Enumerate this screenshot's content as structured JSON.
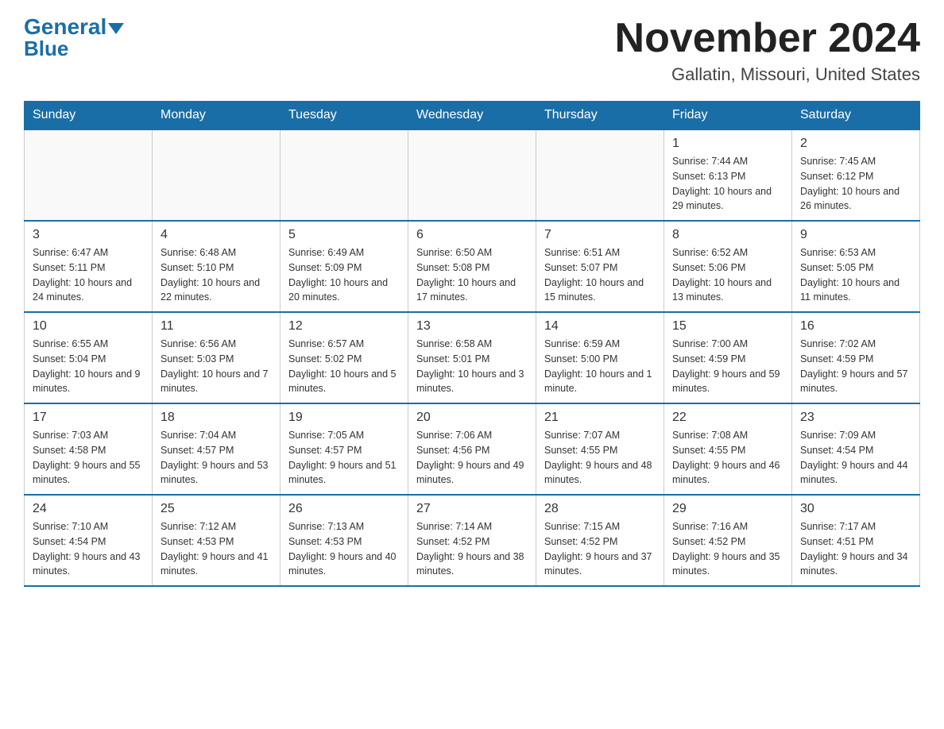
{
  "header": {
    "logo_general": "General",
    "logo_blue": "Blue",
    "month_title": "November 2024",
    "location": "Gallatin, Missouri, United States"
  },
  "weekdays": [
    "Sunday",
    "Monday",
    "Tuesday",
    "Wednesday",
    "Thursday",
    "Friday",
    "Saturday"
  ],
  "weeks": [
    [
      {
        "day": "",
        "info": ""
      },
      {
        "day": "",
        "info": ""
      },
      {
        "day": "",
        "info": ""
      },
      {
        "day": "",
        "info": ""
      },
      {
        "day": "",
        "info": ""
      },
      {
        "day": "1",
        "info": "Sunrise: 7:44 AM\nSunset: 6:13 PM\nDaylight: 10 hours and 29 minutes."
      },
      {
        "day": "2",
        "info": "Sunrise: 7:45 AM\nSunset: 6:12 PM\nDaylight: 10 hours and 26 minutes."
      }
    ],
    [
      {
        "day": "3",
        "info": "Sunrise: 6:47 AM\nSunset: 5:11 PM\nDaylight: 10 hours and 24 minutes."
      },
      {
        "day": "4",
        "info": "Sunrise: 6:48 AM\nSunset: 5:10 PM\nDaylight: 10 hours and 22 minutes."
      },
      {
        "day": "5",
        "info": "Sunrise: 6:49 AM\nSunset: 5:09 PM\nDaylight: 10 hours and 20 minutes."
      },
      {
        "day": "6",
        "info": "Sunrise: 6:50 AM\nSunset: 5:08 PM\nDaylight: 10 hours and 17 minutes."
      },
      {
        "day": "7",
        "info": "Sunrise: 6:51 AM\nSunset: 5:07 PM\nDaylight: 10 hours and 15 minutes."
      },
      {
        "day": "8",
        "info": "Sunrise: 6:52 AM\nSunset: 5:06 PM\nDaylight: 10 hours and 13 minutes."
      },
      {
        "day": "9",
        "info": "Sunrise: 6:53 AM\nSunset: 5:05 PM\nDaylight: 10 hours and 11 minutes."
      }
    ],
    [
      {
        "day": "10",
        "info": "Sunrise: 6:55 AM\nSunset: 5:04 PM\nDaylight: 10 hours and 9 minutes."
      },
      {
        "day": "11",
        "info": "Sunrise: 6:56 AM\nSunset: 5:03 PM\nDaylight: 10 hours and 7 minutes."
      },
      {
        "day": "12",
        "info": "Sunrise: 6:57 AM\nSunset: 5:02 PM\nDaylight: 10 hours and 5 minutes."
      },
      {
        "day": "13",
        "info": "Sunrise: 6:58 AM\nSunset: 5:01 PM\nDaylight: 10 hours and 3 minutes."
      },
      {
        "day": "14",
        "info": "Sunrise: 6:59 AM\nSunset: 5:00 PM\nDaylight: 10 hours and 1 minute."
      },
      {
        "day": "15",
        "info": "Sunrise: 7:00 AM\nSunset: 4:59 PM\nDaylight: 9 hours and 59 minutes."
      },
      {
        "day": "16",
        "info": "Sunrise: 7:02 AM\nSunset: 4:59 PM\nDaylight: 9 hours and 57 minutes."
      }
    ],
    [
      {
        "day": "17",
        "info": "Sunrise: 7:03 AM\nSunset: 4:58 PM\nDaylight: 9 hours and 55 minutes."
      },
      {
        "day": "18",
        "info": "Sunrise: 7:04 AM\nSunset: 4:57 PM\nDaylight: 9 hours and 53 minutes."
      },
      {
        "day": "19",
        "info": "Sunrise: 7:05 AM\nSunset: 4:57 PM\nDaylight: 9 hours and 51 minutes."
      },
      {
        "day": "20",
        "info": "Sunrise: 7:06 AM\nSunset: 4:56 PM\nDaylight: 9 hours and 49 minutes."
      },
      {
        "day": "21",
        "info": "Sunrise: 7:07 AM\nSunset: 4:55 PM\nDaylight: 9 hours and 48 minutes."
      },
      {
        "day": "22",
        "info": "Sunrise: 7:08 AM\nSunset: 4:55 PM\nDaylight: 9 hours and 46 minutes."
      },
      {
        "day": "23",
        "info": "Sunrise: 7:09 AM\nSunset: 4:54 PM\nDaylight: 9 hours and 44 minutes."
      }
    ],
    [
      {
        "day": "24",
        "info": "Sunrise: 7:10 AM\nSunset: 4:54 PM\nDaylight: 9 hours and 43 minutes."
      },
      {
        "day": "25",
        "info": "Sunrise: 7:12 AM\nSunset: 4:53 PM\nDaylight: 9 hours and 41 minutes."
      },
      {
        "day": "26",
        "info": "Sunrise: 7:13 AM\nSunset: 4:53 PM\nDaylight: 9 hours and 40 minutes."
      },
      {
        "day": "27",
        "info": "Sunrise: 7:14 AM\nSunset: 4:52 PM\nDaylight: 9 hours and 38 minutes."
      },
      {
        "day": "28",
        "info": "Sunrise: 7:15 AM\nSunset: 4:52 PM\nDaylight: 9 hours and 37 minutes."
      },
      {
        "day": "29",
        "info": "Sunrise: 7:16 AM\nSunset: 4:52 PM\nDaylight: 9 hours and 35 minutes."
      },
      {
        "day": "30",
        "info": "Sunrise: 7:17 AM\nSunset: 4:51 PM\nDaylight: 9 hours and 34 minutes."
      }
    ]
  ]
}
